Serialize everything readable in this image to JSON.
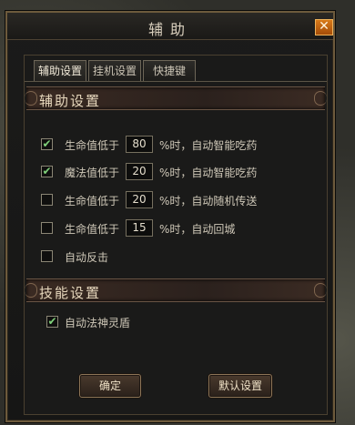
{
  "window": {
    "title": "辅助",
    "close_glyph": "✕"
  },
  "tabs": [
    {
      "label": "辅助设置",
      "active": true
    },
    {
      "label": "挂机设置",
      "active": false
    },
    {
      "label": "快捷键",
      "active": false
    }
  ],
  "section_assist": {
    "title": "辅助设置"
  },
  "options": [
    {
      "checked": true,
      "label": "生命值低于",
      "value": "80",
      "suffix": "%时，自动智能吃药"
    },
    {
      "checked": true,
      "label": "魔法值低于",
      "value": "20",
      "suffix": "%时，自动智能吃药"
    },
    {
      "checked": false,
      "label": "生命值低于",
      "value": "20",
      "suffix": "%时，自动随机传送"
    },
    {
      "checked": false,
      "label": "生命值低于",
      "value": "15",
      "suffix": "%时，自动回城"
    },
    {
      "checked": false,
      "label": "自动反击"
    }
  ],
  "section_skill": {
    "title": "技能设置"
  },
  "skill_option": {
    "checked": true,
    "label": "自动法神灵盾"
  },
  "buttons": {
    "confirm": "确定",
    "default": "默认设置"
  },
  "check_glyph": "✔"
}
